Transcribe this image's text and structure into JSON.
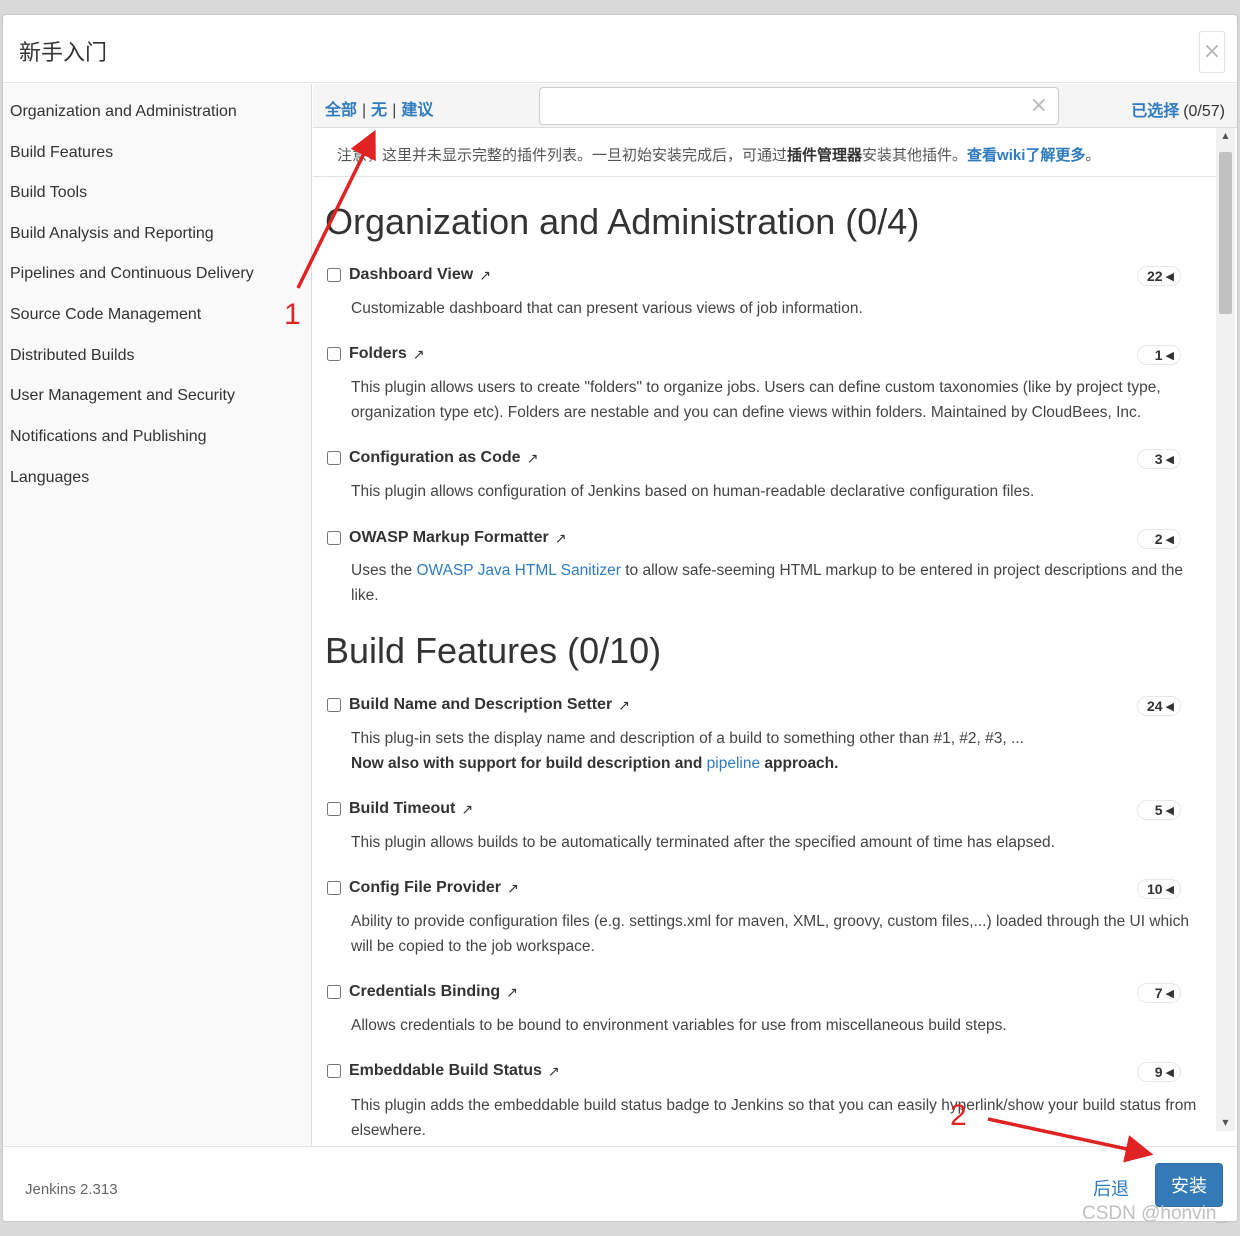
{
  "dialog": {
    "title": "新手入门",
    "close_label": "×"
  },
  "sidebar": {
    "items": [
      {
        "label": "Organization and Administration"
      },
      {
        "label": "Build Features"
      },
      {
        "label": "Build Tools"
      },
      {
        "label": "Build Analysis and Reporting"
      },
      {
        "label": "Pipelines and Continuous Delivery"
      },
      {
        "label": "Source Code Management"
      },
      {
        "label": "Distributed Builds"
      },
      {
        "label": "User Management and Security"
      },
      {
        "label": "Notifications and Publishing"
      },
      {
        "label": "Languages"
      }
    ]
  },
  "toolbar": {
    "filter_all": "全部",
    "filter_none": "无",
    "filter_suggested": "建议",
    "separator": "|",
    "search_value": "",
    "search_placeholder": "",
    "clear_label": "×",
    "selected_label": "已选择",
    "selected_count": "(0/57)"
  },
  "notice": {
    "text_1": "注意，这里并未显示完整的插件列表。一旦初始安装完成后，可通过",
    "text_bold": "插件管理器",
    "text_2": "安装其他插件。",
    "link_text": "查看wiki了解更多",
    "text_3": "。"
  },
  "sections": [
    {
      "title": "Organization and Administration (0/4)",
      "plugins": [
        {
          "name": "Dashboard View",
          "deps": "22",
          "desc": "Customizable dashboard that can present various views of job information."
        },
        {
          "name": "Folders",
          "deps": "1",
          "desc": "This plugin allows users to create \"folders\" to organize jobs. Users can define custom taxonomies (like by project type, organization type etc). Folders are nestable and you can define views within folders. Maintained by CloudBees, Inc."
        },
        {
          "name": "Configuration as Code",
          "deps": "3",
          "desc": "This plugin allows configuration of Jenkins based on human-readable declarative configuration files."
        },
        {
          "name": "OWASP Markup Formatter",
          "deps": "2",
          "desc_pre": "Uses the ",
          "desc_link": "OWASP Java HTML Sanitizer",
          "desc_post": " to allow safe-seeming HTML markup to be entered in project descriptions and the like."
        }
      ]
    },
    {
      "title": "Build Features (0/10)",
      "plugins": [
        {
          "name": "Build Name and Description Setter",
          "deps": "24",
          "desc": "This plug-in sets the display name and description of a build to something other than #1, #2, #3, ...",
          "desc_bold_pre": "Now also with support for build description and ",
          "desc_bold_link": "pipeline",
          "desc_bold_post": " approach."
        },
        {
          "name": "Build Timeout",
          "deps": "5",
          "desc": "This plugin allows builds to be automatically terminated after the specified amount of time has elapsed."
        },
        {
          "name": "Config File Provider",
          "deps": "10",
          "desc": "Ability to provide configuration files (e.g. settings.xml for maven, XML, groovy, custom files,...) loaded through the UI which will be copied to the job workspace."
        },
        {
          "name": "Credentials Binding",
          "deps": "7",
          "desc": "Allows credentials to be bound to environment variables for use from miscellaneous build steps."
        },
        {
          "name": "Embeddable Build Status",
          "deps": "9",
          "desc": "This plugin adds the embeddable build status badge to Jenkins so that you can easily hyperlink/show your build status from elsewhere."
        }
      ]
    }
  ],
  "icons": {
    "external_link": "↗",
    "expand_triangle": "◀",
    "scroll_up": "▲",
    "scroll_down": "▼"
  },
  "footer": {
    "version": "Jenkins 2.313",
    "back_label": "后退",
    "install_label": "安装"
  },
  "annotations": {
    "label_1": "1",
    "label_2": "2",
    "color": "#e02222"
  },
  "watermark": "CSDN @honvin_"
}
